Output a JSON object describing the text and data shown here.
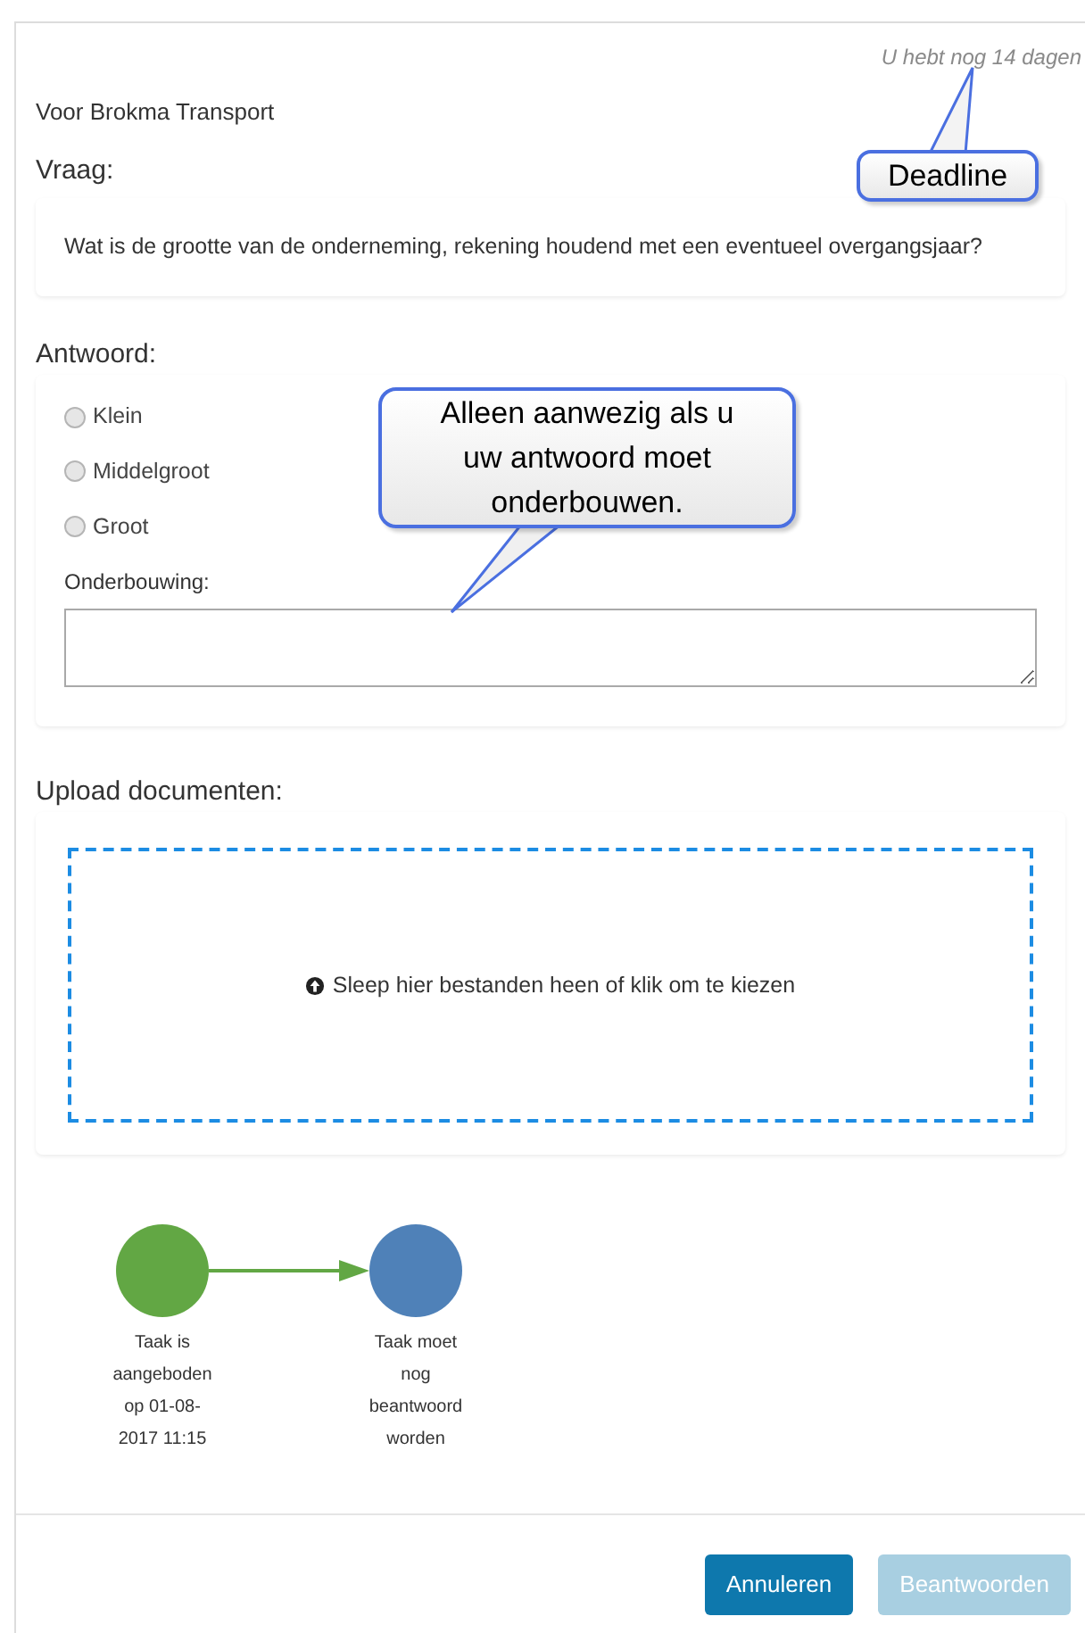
{
  "deadline_text": "U hebt nog 14 dagen",
  "customer": "Voor Brokma Transport",
  "question": {
    "heading": "Vraag:",
    "text": "Wat is de grootte van de onderneming, rekening houdend met een eventueel overgangsjaar?"
  },
  "answer": {
    "heading": "Antwoord:",
    "options": [
      {
        "label": "Klein",
        "selected": false
      },
      {
        "label": "Middelgroot",
        "selected": false
      },
      {
        "label": "Groot",
        "selected": false
      }
    ],
    "motivation_label": "Onderbouwing:"
  },
  "upload": {
    "heading": "Upload documenten:",
    "dropzone_text": "Sleep hier bestanden heen of klik om te kiezen"
  },
  "workflow": [
    {
      "label": "Taak is aangeboden op 01-08-2017 11:15",
      "color": "#62a744"
    },
    {
      "label": "Taak moet nog beantwoord worden",
      "color": "#4f81b8"
    }
  ],
  "buttons": [
    {
      "label": "Annuleren",
      "disabled": false
    },
    {
      "label": "Beantwoorden",
      "disabled": true
    }
  ],
  "callouts": [
    {
      "text": "Deadline"
    },
    {
      "text": "Alleen aanwezig als u uw antwoord moet onderbouwen."
    }
  ]
}
